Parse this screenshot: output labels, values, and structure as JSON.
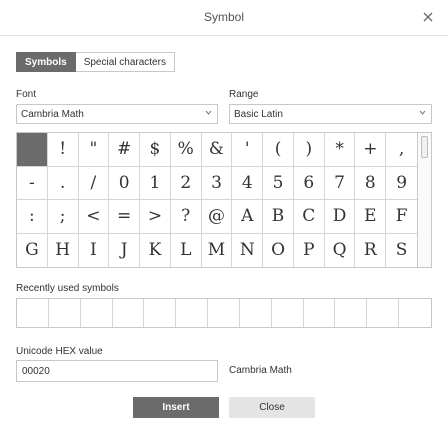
{
  "window": {
    "title": "Symbol"
  },
  "tabs": [
    {
      "label": "Symbols",
      "active": true
    },
    {
      "label": "Special characters",
      "active": false
    }
  ],
  "font": {
    "label": "Font",
    "value": "Cambria Math"
  },
  "range": {
    "label": "Range",
    "value": "Basic Latin"
  },
  "symbols": [
    " ",
    "!",
    "\"",
    "#",
    "$",
    "%",
    "&",
    "'",
    "(",
    ")",
    "*",
    "+",
    ",",
    "-",
    ".",
    "/",
    "0",
    "1",
    "2",
    "3",
    "4",
    "5",
    "6",
    "7",
    "8",
    "9",
    ":",
    ";",
    "<",
    "=",
    ">",
    "?",
    "@",
    "A",
    "B",
    "C",
    "D",
    "E",
    "F",
    "G",
    "H",
    "I",
    "J",
    "K",
    "L",
    "M",
    "N",
    "O",
    "P",
    "Q",
    "R",
    "S"
  ],
  "recent": {
    "label": "Recently used symbols"
  },
  "unicode": {
    "label": "Unicode HEX value",
    "value": "00020",
    "font_name": "Cambria Math"
  },
  "buttons": {
    "insert": "Insert",
    "close": "Close"
  },
  "colors": {
    "accent": "#6b6b6b",
    "border": "#c8c8c8"
  }
}
